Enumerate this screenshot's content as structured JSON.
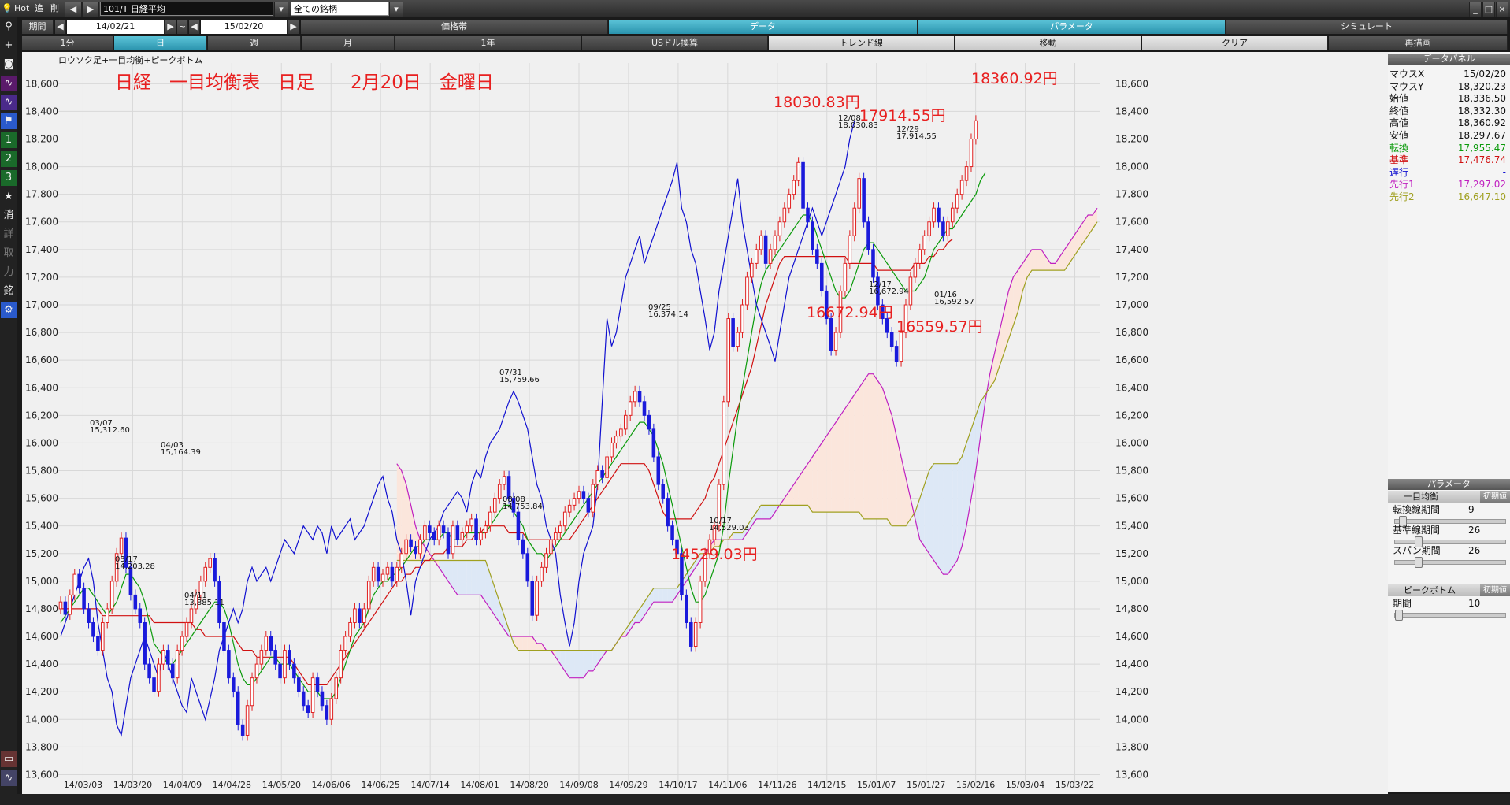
{
  "toolbar": {
    "hot": "Hot",
    "add": "追",
    "del": "削",
    "symbol": "101/T 日経平均",
    "filter": "全ての銘柄",
    "period_label": "期間",
    "date_from": "14/02/21",
    "tilde": "~",
    "date_to": "15/02/20",
    "tabs": [
      "価格帯",
      "データ",
      "パラメータ",
      "シミュレート"
    ],
    "row3": [
      "1分",
      "日",
      "週",
      "月",
      "1年",
      "USドル換算",
      "トレンド線",
      "移動",
      "クリア",
      "再描画"
    ]
  },
  "left_tools": [
    "1",
    "2",
    "3",
    "★",
    "消",
    "詳",
    "取",
    "力",
    "銘"
  ],
  "chart_title_small": "ロウソク足+一目均衡+ピークボトム",
  "annotation_title": "日経　一目均衡表　日足　　2月20日　金曜日",
  "colors": {
    "up": "#e02020",
    "down": "#1a1adb",
    "tenkan": "#0a9a0a",
    "kijun": "#d01010",
    "chikou": "#1010d0",
    "spanA": "#c020c0",
    "spanB": "#a0a020",
    "cloud_up": "#fbe6dc",
    "cloud_down": "#dde8f6",
    "annot": "#e82020"
  },
  "big_annotations": [
    "18030.83円",
    "17914.55円",
    "18360.92円",
    "16672.94円",
    "16559.57円",
    "14529.03円"
  ],
  "peaks": [
    {
      "date": "03/07",
      "value": "15,312.60"
    },
    {
      "date": "04/03",
      "value": "15,164.39"
    },
    {
      "date": "03/17",
      "value": "14,203.28"
    },
    {
      "date": "04/11",
      "value": "13,885.11"
    },
    {
      "date": "07/31",
      "value": "15,759.66"
    },
    {
      "date": "08/08",
      "value": "14,753.84"
    },
    {
      "date": "09/25",
      "value": "16,374.14"
    },
    {
      "date": "10/17",
      "value": "14,529.03"
    },
    {
      "date": "12/08",
      "value": "18,030.83"
    },
    {
      "date": "12/29",
      "value": "17,914.55"
    },
    {
      "date": "12/17",
      "value": "16,672.94"
    },
    {
      "date": "01/16",
      "value": "16,592.57"
    }
  ],
  "panel": {
    "title": "データパネル",
    "rows": [
      {
        "k": "マウスX",
        "v": "15/02/20",
        "c": "#111"
      },
      {
        "k": "マウスY",
        "v": "18,320.23",
        "c": "#111"
      },
      {
        "k": "始値",
        "v": "18,336.50",
        "c": "#111"
      },
      {
        "k": "終値",
        "v": "18,332.30",
        "c": "#111"
      },
      {
        "k": "高値",
        "v": "18,360.92",
        "c": "#111"
      },
      {
        "k": "安値",
        "v": "18,297.67",
        "c": "#111"
      },
      {
        "k": "転換",
        "v": "17,955.47",
        "c": "#0a9a0a"
      },
      {
        "k": "基準",
        "v": "17,476.74",
        "c": "#d01010"
      },
      {
        "k": "遅行",
        "v": "-",
        "c": "#1010d0"
      },
      {
        "k": "先行1",
        "v": "17,297.02",
        "c": "#c020c0"
      },
      {
        "k": "先行2",
        "v": "16,647.10",
        "c": "#a0a020"
      }
    ],
    "param_title": "パラメータ",
    "ichimoku_title": "一目均衡",
    "init": "初期値",
    "params": [
      {
        "k": "転換線期間",
        "v": "9",
        "pos": 0.04
      },
      {
        "k": "基準線期間",
        "v": "26",
        "pos": 0.19
      },
      {
        "k": "スパン期間",
        "v": "26",
        "pos": 0.19
      }
    ],
    "pb_title": "ピークボトム",
    "pb_params": [
      {
        "k": "期間",
        "v": "10",
        "pos": 0.0
      }
    ]
  },
  "chart_data": {
    "type": "candlestick",
    "ylim": [
      13500,
      18750
    ],
    "yticks": [
      "13,600",
      "13,800",
      "14,000",
      "14,200",
      "14,400",
      "14,600",
      "14,800",
      "15,000",
      "15,200",
      "15,400",
      "15,600",
      "15,800",
      "16,000",
      "16,200",
      "16,400",
      "16,600",
      "16,800",
      "17,000",
      "17,200",
      "17,400",
      "17,600",
      "17,800",
      "18,000",
      "18,200",
      "18,400",
      "18,600"
    ],
    "xticks": [
      "14/03/03",
      "14/03/20",
      "14/04/09",
      "14/04/28",
      "14/05/20",
      "14/06/06",
      "14/06/25",
      "14/07/14",
      "14/08/01",
      "14/08/20",
      "14/09/08",
      "14/09/29",
      "14/10/17",
      "14/11/06",
      "14/11/26",
      "14/12/15",
      "15/01/07",
      "15/01/27",
      "15/02/16",
      "15/03/04",
      "15/03/22"
    ],
    "close": [
      14850,
      14760,
      14900,
      15050,
      14950,
      14800,
      14700,
      14600,
      14500,
      14700,
      14800,
      15000,
      15200,
      15312,
      15100,
      14900,
      14800,
      14700,
      14400,
      14300,
      14203,
      14400,
      14500,
      14400,
      14300,
      14500,
      14600,
      14700,
      14800,
      14900,
      15000,
      15100,
      15164,
      15000,
      14700,
      14500,
      14300,
      14200,
      13960,
      13885,
      14100,
      14300,
      14400,
      14500,
      14600,
      14500,
      14400,
      14300,
      14500,
      14400,
      14300,
      14200,
      14100,
      14050,
      14300,
      14200,
      14100,
      14000,
      14150,
      14300,
      14500,
      14600,
      14700,
      14800,
      14700,
      14800,
      15000,
      15100,
      15000,
      15050,
      15100,
      15000,
      15100,
      15200,
      15300,
      15250,
      15200,
      15300,
      15400,
      15350,
      15300,
      15400,
      15350,
      15200,
      15400,
      15300,
      15350,
      15400,
      15450,
      15300,
      15350,
      15400,
      15500,
      15600,
      15700,
      15759,
      15600,
      15500,
      15300,
      15200,
      15000,
      14753,
      15000,
      15100,
      15200,
      15300,
      15350,
      15400,
      15500,
      15550,
      15600,
      15650,
      15600,
      15500,
      15700,
      15800,
      15750,
      15900,
      16000,
      16050,
      16100,
      16200,
      16300,
      16374,
      16300,
      16200,
      16100,
      15900,
      15700,
      15600,
      15400,
      15300,
      15200,
      14900,
      14700,
      14529,
      14700,
      15000,
      15200,
      15300,
      15400,
      15700,
      16300,
      16900,
      16700,
      16800,
      17000,
      17200,
      17300,
      17400,
      17500,
      17300,
      17400,
      17500,
      17600,
      17700,
      17800,
      17900,
      18030,
      17700,
      17600,
      17400,
      17300,
      17100,
      16900,
      16672,
      16800,
      17100,
      17300,
      17500,
      17700,
      17914,
      17600,
      17400,
      17200,
      17000,
      16900,
      16800,
      16700,
      16592,
      16800,
      17000,
      17200,
      17300,
      17400,
      17500,
      17600,
      17700,
      17600,
      17500,
      17600,
      17700,
      17800,
      17900,
      18000,
      18200,
      18332
    ],
    "open": [
      14800,
      14850,
      14760,
      14900,
      15050,
      14950,
      14800,
      14700,
      14600,
      14500,
      14700,
      14800,
      15000,
      15200,
      15312,
      15100,
      14900,
      14800,
      14700,
      14400,
      14300,
      14203,
      14400,
      14500,
      14400,
      14300,
      14500,
      14600,
      14700,
      14800,
      14900,
      15000,
      15100,
      15164,
      15000,
      14700,
      14500,
      14300,
      14200,
      13960,
      13885,
      14100,
      14300,
      14400,
      14500,
      14600,
      14500,
      14400,
      14300,
      14500,
      14400,
      14300,
      14200,
      14100,
      14050,
      14300,
      14200,
      14100,
      14000,
      14150,
      14300,
      14500,
      14600,
      14700,
      14800,
      14700,
      14800,
      15000,
      15100,
      15000,
      15050,
      15100,
      15000,
      15100,
      15200,
      15300,
      15250,
      15200,
      15300,
      15400,
      15350,
      15300,
      15400,
      15350,
      15200,
      15400,
      15300,
      15350,
      15400,
      15450,
      15300,
      15350,
      15400,
      15500,
      15600,
      15700,
      15759,
      15600,
      15500,
      15300,
      15200,
      15000,
      14753,
      15000,
      15100,
      15200,
      15300,
      15350,
      15400,
      15500,
      15550,
      15600,
      15650,
      15600,
      15500,
      15700,
      15800,
      15750,
      15900,
      16000,
      16050,
      16100,
      16200,
      16300,
      16374,
      16300,
      16200,
      16100,
      15900,
      15700,
      15600,
      15400,
      15300,
      15200,
      14900,
      14700,
      14529,
      14700,
      15000,
      15200,
      15300,
      15400,
      15700,
      16300,
      16900,
      16700,
      16800,
      17000,
      17200,
      17300,
      17400,
      17500,
      17300,
      17400,
      17500,
      17600,
      17700,
      17800,
      17900,
      18030,
      17700,
      17600,
      17400,
      17300,
      17100,
      16900,
      16672,
      16800,
      17100,
      17300,
      17500,
      17700,
      17914,
      17600,
      17400,
      17200,
      17000,
      16900,
      16800,
      16700,
      16592,
      16800,
      17000,
      17200,
      17300,
      17400,
      17500,
      17600,
      17700,
      17600,
      17500,
      17600,
      17700,
      17800,
      17900,
      18000,
      18200
    ],
    "tenkan": [
      14700,
      14750,
      14800,
      14850,
      14900,
      14950,
      14950,
      14900,
      14850,
      14800,
      14750,
      14800,
      14850,
      14950,
      15050,
      15050,
      15000,
      14950,
      14850,
      14700,
      14550,
      14500,
      14450,
      14400,
      14400,
      14450,
      14500,
      14550,
      14600,
      14650,
      14700,
      14750,
      14800,
      14850,
      14850,
      14800,
      14700,
      14550,
      14400,
      14300,
      14250,
      14250,
      14300,
      14350,
      14400,
      14450,
      14450,
      14400,
      14400,
      14400,
      14350,
      14300,
      14250,
      14200,
      14200,
      14200,
      14150,
      14150,
      14150,
      14200,
      14300,
      14400,
      14500,
      14600,
      14650,
      14700,
      14800,
      14900,
      14950,
      15000,
      15000,
      15050,
      15050,
      15100,
      15150,
      15200,
      15250,
      15250,
      15300,
      15300,
      15300,
      15300,
      15350,
      15350,
      15300,
      15300,
      15300,
      15350,
      15350,
      15350,
      15350,
      15350,
      15400,
      15450,
      15500,
      15550,
      15550,
      15500,
      15450,
      15400,
      15300,
      15250,
      15200,
      15200,
      15150,
      15200,
      15250,
      15300,
      15350,
      15400,
      15450,
      15500,
      15550,
      15600,
      15650,
      15700,
      15750,
      15800,
      15850,
      15900,
      15950,
      16000,
      16050,
      16100,
      16150,
      16150,
      16100,
      16050,
      15950,
      15850,
      15700,
      15550,
      15400,
      15250,
      15100,
      14950,
      14850,
      14850,
      14900,
      15000,
      15100,
      15200,
      15400,
      15700,
      15950,
      16200,
      16400,
      16600,
      16800,
      17000,
      17150,
      17250,
      17300,
      17350,
      17400,
      17450,
      17500,
      17550,
      17600,
      17650,
      17650,
      17600,
      17500,
      17400,
      17300,
      17200,
      17100,
      17050,
      17050,
      17100,
      17200,
      17300,
      17400,
      17450,
      17450,
      17400,
      17350,
      17300,
      17250,
      17200,
      17150,
      17100,
      17100,
      17100,
      17150,
      17200,
      17300,
      17400,
      17450,
      17500,
      17550,
      17550,
      17600,
      17650,
      17700,
      17750,
      17800,
      17900,
      17955
    ],
    "kijun": [
      14800,
      14800,
      14800,
      14800,
      14800,
      14800,
      14800,
      14800,
      14800,
      14750,
      14750,
      14750,
      14750,
      14750,
      14750,
      14750,
      14750,
      14750,
      14750,
      14750,
      14700,
      14700,
      14700,
      14700,
      14700,
      14700,
      14700,
      14700,
      14700,
      14650,
      14650,
      14600,
      14600,
      14600,
      14600,
      14600,
      14600,
      14600,
      14550,
      14500,
      14500,
      14500,
      14450,
      14450,
      14450,
      14450,
      14450,
      14450,
      14450,
      14450,
      14400,
      14350,
      14300,
      14250,
      14250,
      14250,
      14250,
      14250,
      14300,
      14350,
      14400,
      14450,
      14500,
      14550,
      14600,
      14650,
      14700,
      14750,
      14800,
      14850,
      14900,
      14950,
      15000,
      15000,
      15050,
      15050,
      15100,
      15100,
      15150,
      15150,
      15200,
      15200,
      15200,
      15250,
      15250,
      15250,
      15250,
      15300,
      15300,
      15350,
      15350,
      15400,
      15400,
      15400,
      15400,
      15400,
      15350,
      15350,
      15350,
      15350,
      15300,
      15300,
      15300,
      15300,
      15300,
      15300,
      15300,
      15300,
      15300,
      15300,
      15350,
      15400,
      15450,
      15500,
      15550,
      15600,
      15650,
      15700,
      15750,
      15800,
      15850,
      15850,
      15850,
      15850,
      15850,
      15850,
      15800,
      15700,
      15600,
      15500,
      15450,
      15450,
      15450,
      15450,
      15450,
      15450,
      15500,
      15550,
      15600,
      15700,
      15750,
      15850,
      15950,
      16050,
      16150,
      16250,
      16350,
      16450,
      16550,
      16700,
      16850,
      17000,
      17100,
      17200,
      17300,
      17350,
      17350,
      17350,
      17350,
      17350,
      17350,
      17350,
      17350,
      17350,
      17350,
      17350,
      17350,
      17350,
      17350,
      17300,
      17300,
      17300,
      17300,
      17300,
      17300,
      17250,
      17250,
      17250,
      17250,
      17250,
      17250,
      17250,
      17250,
      17300,
      17300,
      17300,
      17350,
      17350,
      17400,
      17400,
      17450,
      17476
    ],
    "spanA": [
      15850,
      15800,
      15700,
      15550,
      15400,
      15300,
      15250,
      15200,
      15150,
      15100,
      15050,
      15000,
      14950,
      14900,
      14900,
      14900,
      14900,
      14900,
      14900,
      14850,
      14800,
      14750,
      14700,
      14650,
      14600,
      14600,
      14600,
      14600,
      14600,
      14600,
      14550,
      14550,
      14500,
      14500,
      14450,
      14400,
      14350,
      14300,
      14300,
      14300,
      14300,
      14350,
      14350,
      14400,
      14450,
      14500,
      14500,
      14550,
      14600,
      14600,
      14650,
      14700,
      14700,
      14750,
      14800,
      14850,
      14850,
      14850,
      14850,
      14850,
      14900,
      14950,
      15000,
      15050,
      15100,
      15150,
      15200,
      15250,
      15300,
      15300,
      15300,
      15300,
      15300,
      15300,
      15300,
      15350,
      15400,
      15450,
      15450,
      15450,
      15450,
      15500,
      15550,
      15600,
      15650,
      15700,
      15750,
      15800,
      15850,
      15900,
      15950,
      16000,
      16050,
      16100,
      16150,
      16200,
      16250,
      16300,
      16350,
      16400,
      16450,
      16500,
      16500,
      16450,
      16400,
      16300,
      16200,
      16050,
      15900,
      15750,
      15600,
      15450,
      15300,
      15250,
      15200,
      15150,
      15100,
      15050,
      15050,
      15100,
      15150,
      15250,
      15400,
      15600,
      15800,
      16050,
      16300,
      16500,
      16650,
      16800,
      16950,
      17100,
      17200,
      17250,
      17300,
      17350,
      17400,
      17400,
      17400,
      17350,
      17300,
      17300,
      17350,
      17400,
      17450,
      17500,
      17550,
      17600,
      17650,
      17650,
      17700
    ],
    "spanB": [
      15150,
      15150,
      15150,
      15150,
      15150,
      15150,
      15150,
      15150,
      15150,
      15150,
      15150,
      15150,
      15150,
      15150,
      15150,
      15150,
      15150,
      15150,
      15150,
      15150,
      15050,
      14950,
      14850,
      14750,
      14650,
      14550,
      14500,
      14500,
      14500,
      14500,
      14500,
      14500,
      14500,
      14500,
      14500,
      14500,
      14500,
      14500,
      14500,
      14500,
      14500,
      14500,
      14500,
      14500,
      14500,
      14500,
      14500,
      14550,
      14600,
      14650,
      14700,
      14750,
      14800,
      14850,
      14900,
      14950,
      14950,
      14950,
      14950,
      14950,
      14950,
      15000,
      15050,
      15100,
      15150,
      15200,
      15200,
      15200,
      15250,
      15250,
      15300,
      15300,
      15350,
      15350,
      15350,
      15400,
      15450,
      15500,
      15550,
      15550,
      15550,
      15550,
      15550,
      15550,
      15550,
      15550,
      15550,
      15550,
      15550,
      15500,
      15500,
      15500,
      15500,
      15500,
      15500,
      15500,
      15500,
      15500,
      15500,
      15500,
      15450,
      15450,
      15450,
      15450,
      15450,
      15450,
      15400,
      15400,
      15400,
      15400,
      15450,
      15500,
      15600,
      15700,
      15800,
      15850,
      15850,
      15850,
      15850,
      15850,
      15850,
      15900,
      16000,
      16100,
      16200,
      16300,
      16350,
      16400,
      16450,
      16550,
      16650,
      16750,
      16850,
      16950,
      17100,
      17200,
      17250,
      17250,
      17250,
      17250,
      17250,
      17250,
      17250,
      17250,
      17300,
      17350,
      17400,
      17450,
      17500,
      17550,
      17600
    ]
  }
}
